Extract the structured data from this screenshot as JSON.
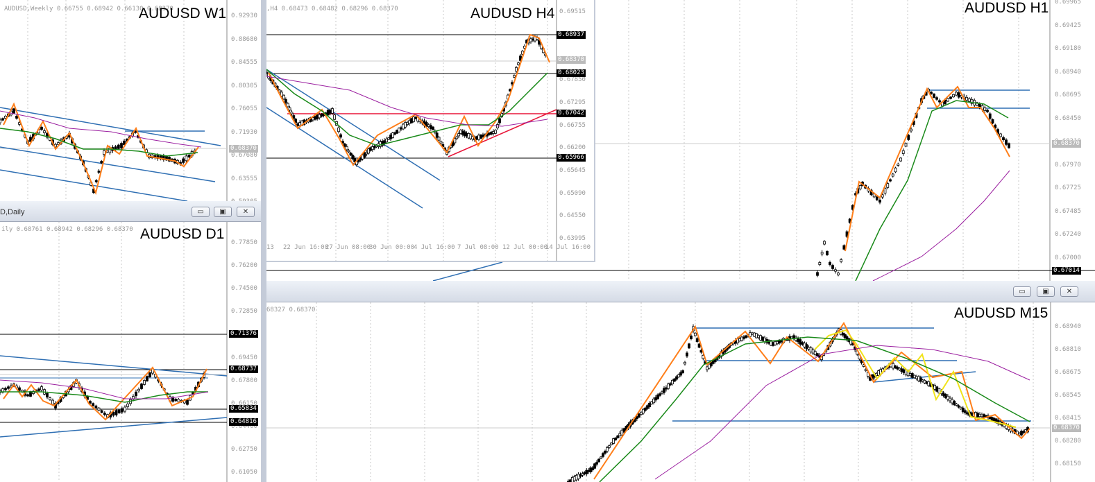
{
  "charts": {
    "h1": {
      "title": "AUDUSD H1",
      "y_labels": [
        "0.69965",
        "0.69425",
        "0.69180",
        "0.68940",
        "0.68695",
        "0.68450",
        "0.68210",
        "0.67970",
        "0.67725",
        "0.67485",
        "0.67240",
        "0.67000"
      ],
      "current_price": "0.68370",
      "level_tag": "0.67014"
    },
    "w1": {
      "title": "AUDUSD W1",
      "info": "AUDUSD,Weekly  0.66755 0.68942 0.66130 0.68370",
      "y_labels": [
        "0.92930",
        "0.88680",
        "0.84555",
        "0.80305",
        "0.76055",
        "0.71930",
        "0.67680",
        "0.63555",
        "0.59305"
      ],
      "current_price": "0.68370"
    },
    "h4": {
      "title": "AUDUSD H4",
      "info": ",H4  0.68473 0.68482 0.68296 0.68370",
      "y_labels": [
        "0.69515",
        "0.68955",
        "0.68370",
        "0.67850",
        "0.67295",
        "0.66755",
        "0.66200",
        "0.65645",
        "0.65090",
        "0.64550",
        "0.63995"
      ],
      "tags": [
        "0.68937",
        "0.68023",
        "0.67042",
        "0.65966"
      ],
      "current_price": "0.68370",
      "x_labels": [
        "13",
        "22 Jun 16:00",
        "27 Jun 08:00",
        "30 Jun 00:00",
        "4 Jul 16:00",
        "7 Jul 08:00",
        "12 Jul 00:00",
        "14 Jul 16:00"
      ]
    },
    "d1": {
      "window_name": "D,Daily",
      "title": "AUDUSD D1",
      "info": "ily  0.68761 0.68942 0.68296 0.68370",
      "y_labels": [
        "0.77850",
        "0.76200",
        "0.74500",
        "0.72850",
        "0.71376",
        "0.69450",
        "0.68737",
        "0.67800",
        "0.66150",
        "0.65834",
        "0.64816",
        "0.64400",
        "0.62750",
        "0.61050"
      ],
      "tags": [
        "0.71376",
        "0.68737",
        "0.65834",
        "0.64816"
      ],
      "current_price": "0.68370"
    },
    "m15": {
      "title": "AUDUSD M15",
      "info": "68327 0.68370",
      "y_labels": [
        "0.68940",
        "0.68810",
        "0.68675",
        "0.68545",
        "0.68415",
        "0.68280",
        "0.68150"
      ],
      "current_price": "0.68370"
    }
  },
  "window_buttons": {
    "minimize": "▭",
    "maximize": "▣",
    "close": "✕"
  },
  "colors": {
    "zigzag": "#ff7f1a",
    "ma_fast": "#1a8a1a",
    "ma_slow": "#9b1fa0",
    "trendline": "#2f6fb3",
    "level": "#000000",
    "resistance_red": "#e8173a",
    "zigzag_alt": "#f0e31a"
  }
}
